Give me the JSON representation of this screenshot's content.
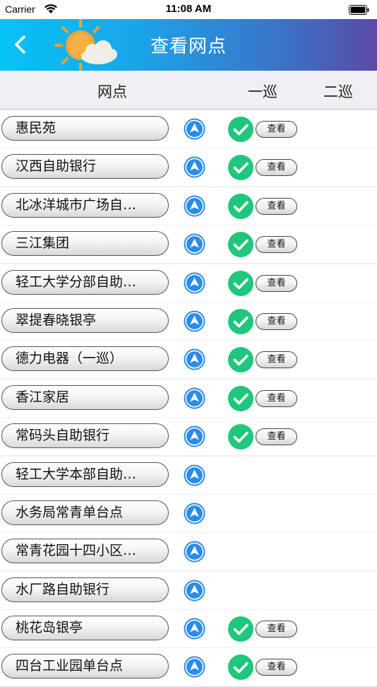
{
  "status_bar": {
    "carrier": "Carrier",
    "time": "11:08 AM"
  },
  "nav": {
    "title": "查看网点"
  },
  "columns": {
    "site": "网点",
    "patrol1": "一巡",
    "patrol2": "二巡"
  },
  "view_label": "查看",
  "colors": {
    "nav_gradient_start": "#06c3f5",
    "nav_gradient_end": "#5b4aa6",
    "check_green": "#1fc67b",
    "nav_icon_blue": "#2b8be8"
  },
  "rows": [
    {
      "name": "惠民苑",
      "patrol1_done": true
    },
    {
      "name": "汉西自助银行",
      "patrol1_done": true
    },
    {
      "name": "北冰洋城市广场自…",
      "patrol1_done": true
    },
    {
      "name": "三江集团",
      "patrol1_done": true
    },
    {
      "name": "轻工大学分部自助…",
      "patrol1_done": true
    },
    {
      "name": "翠提春晓银亭",
      "patrol1_done": true
    },
    {
      "name": "德力电器（一巡）",
      "patrol1_done": true
    },
    {
      "name": "香江家居",
      "patrol1_done": true
    },
    {
      "name": "常码头自助银行",
      "patrol1_done": true
    },
    {
      "name": "轻工大学本部自助…",
      "patrol1_done": false
    },
    {
      "name": "水务局常青单台点",
      "patrol1_done": false
    },
    {
      "name": "常青花园十四小区…",
      "patrol1_done": false
    },
    {
      "name": "水厂路自助银行",
      "patrol1_done": false
    },
    {
      "name": "桃花岛银亭",
      "patrol1_done": true
    },
    {
      "name": "四台工业园单台点",
      "patrol1_done": true
    }
  ]
}
